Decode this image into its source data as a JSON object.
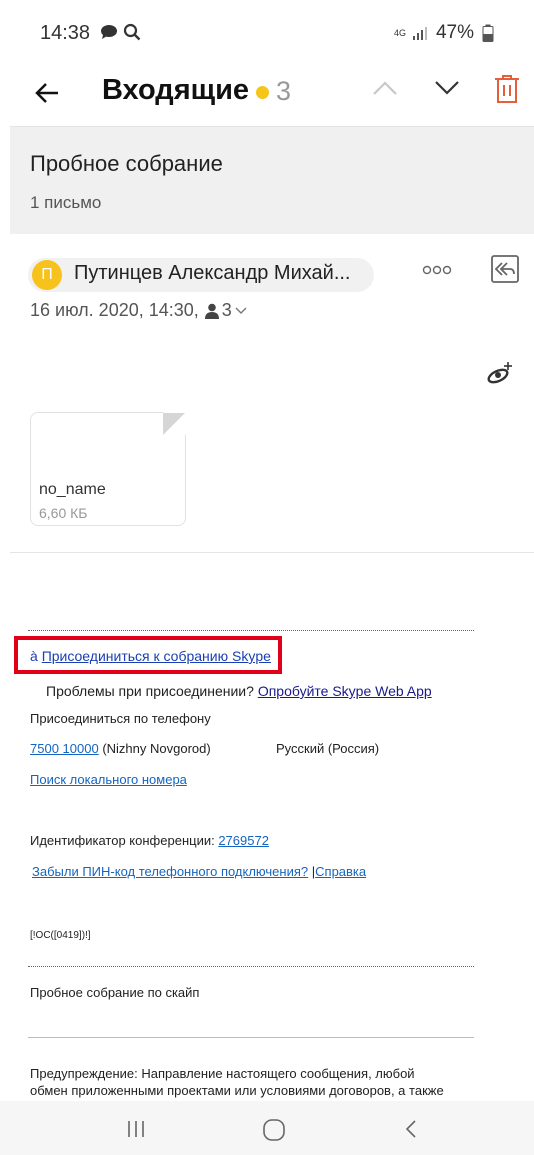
{
  "status_bar": {
    "time": "14:38",
    "network": "4G",
    "battery": "47%"
  },
  "header": {
    "title": "Входящие",
    "unread_count": "3",
    "accent_color": "#f5c518",
    "trash_color": "#e5603a"
  },
  "thread": {
    "subject": "Пробное собрание",
    "count": "1 письмо"
  },
  "message": {
    "avatar_letter": "П",
    "sender": "Путинцев Александр Михай...",
    "date": "16 июл. 2020, 14:30,",
    "recipients": "3"
  },
  "attachment": {
    "name": "no_name",
    "size": "6,60 КБ"
  },
  "body": {
    "join_prefix": "à",
    "join_link": "Присоединиться к собранию Skype",
    "problems_text": "Проблемы при присоединении?",
    "web_app_link": "Опробуйте Skype Web App",
    "phone_join": "Присоединиться по телефону",
    "phone_number": "7500 10000",
    "phone_city": "(Nizhny Novgorod)",
    "phone_lang": "Русский (Россия)",
    "local_number_link": "Поиск локального номера",
    "conference_id_label": "Идентификатор конференции:",
    "conference_id": "2769572",
    "forgot_pin_link": "Забыли ПИН-код телефонного подключения?",
    "help_link": "Справка",
    "code": "[!OC([0419])!]",
    "footer_subject": "Пробное собрание по скайп",
    "warning_line1": "Предупреждение: Направление настоящего сообщения, любой",
    "warning_line2": "обмен приложенными проектами или условиями договоров, а также"
  }
}
